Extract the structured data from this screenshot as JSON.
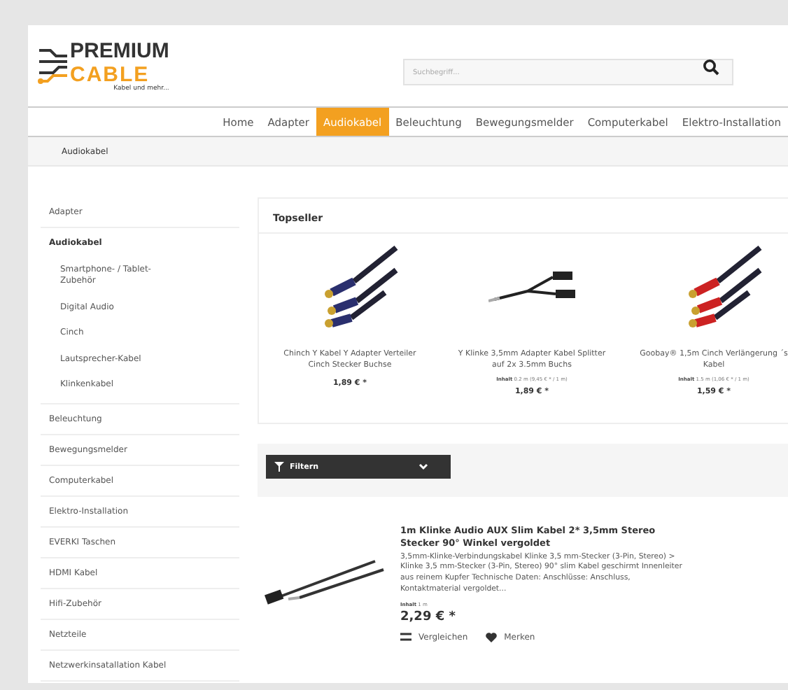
{
  "header": {
    "logo": {
      "line1": "PREMIUM",
      "line2": "CABLE",
      "tagline": "Kabel und mehr..."
    },
    "search": {
      "placeholder": "Suchbegriff..."
    }
  },
  "nav": [
    {
      "label": "Home",
      "selected": false
    },
    {
      "label": "Adapter",
      "selected": false
    },
    {
      "label": "Audiokabel",
      "selected": true
    },
    {
      "label": "Beleuchtung",
      "selected": false
    },
    {
      "label": "Bewegungsmelder",
      "selected": false
    },
    {
      "label": "Computerkabel",
      "selected": false
    },
    {
      "label": "Elektro-Installation",
      "selected": false
    }
  ],
  "breadcrumb": "Audiokabel",
  "sidebar": [
    {
      "label": "Adapter",
      "selected": false
    },
    {
      "label": "Audiokabel",
      "selected": true,
      "children": [
        {
          "label": "Smartphone- / Tablet-Zubehör"
        },
        {
          "label": "Digital Audio"
        },
        {
          "label": "Cinch"
        },
        {
          "label": "Lautsprecher-Kabel"
        },
        {
          "label": "Klinkenkabel"
        }
      ]
    },
    {
      "label": "Beleuchtung",
      "selected": false
    },
    {
      "label": "Bewegungsmelder",
      "selected": false
    },
    {
      "label": "Computerkabel",
      "selected": false
    },
    {
      "label": "Elektro-Installation",
      "selected": false
    },
    {
      "label": "EVERKI Taschen",
      "selected": false
    },
    {
      "label": "HDMI Kabel",
      "selected": false
    },
    {
      "label": "Hifi-Zubehör",
      "selected": false
    },
    {
      "label": "Netzteile",
      "selected": false
    },
    {
      "label": "Netzwerkinsatallation Kabel",
      "selected": false
    }
  ],
  "topseller": {
    "title": "Topseller",
    "products": [
      {
        "kind": "rca",
        "name": "Chinch Y Kabel Y Adapter Verteiler Cinch Stecker Buchse",
        "price": "1,89 € *"
      },
      {
        "kind": "jack",
        "name": "Y Klinke 3,5mm Adapter Kabel Splitter auf 2x 3.5mm Buchs",
        "unit_label": "Inhalt",
        "unit": "0.2 m (9,45 € * / 1 m)",
        "price": "1,89 € *"
      },
      {
        "kind": "rca",
        "name": "Goobay® 1,5m Cinch Verlängerung ´s Kabel",
        "unit_label": "Inhalt",
        "unit": "1.5 m (1,06 € * / 1 m)",
        "price": "1,59 € *"
      }
    ]
  },
  "filter": {
    "label": "Filtern"
  },
  "listing": [
    {
      "title": "1m Klinke Audio AUX Slim Kabel 2* 3,5mm Stereo Stecker 90° Winkel vergoldet",
      "description": "3,5mm-Klinke-Verbindungskabel Klinke 3,5 mm-Stecker (3-Pin, Stereo) > Klinke 3,5 mm-Stecker (3-Pin, Stereo) 90° slim Kabel geschirmt Innenleiter aus reinem Kupfer Technische Daten: Anschlüsse: Anschluss, Kontaktmaterial vergoldet...",
      "unit_label": "Inhalt",
      "unit": "1 m",
      "price": "2,29 € *",
      "compare": "Vergleichen",
      "wishlist": "Merken"
    }
  ]
}
